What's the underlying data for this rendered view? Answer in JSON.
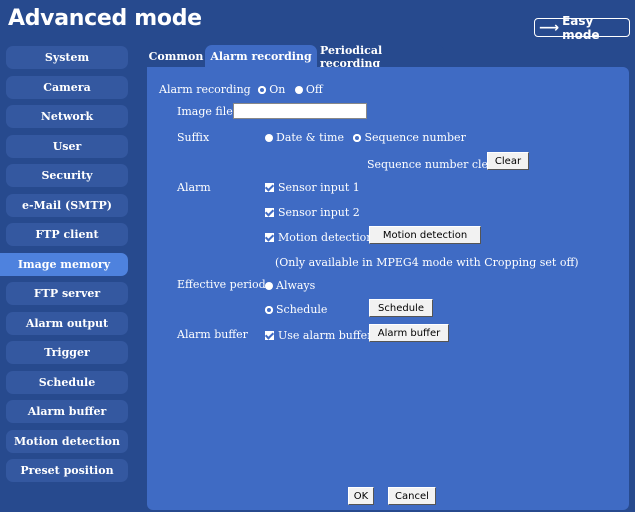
{
  "header": {
    "title": "Advanced mode",
    "easy_mode_label": "Easy mode",
    "easy_mode_icon": "arrow-right-icon"
  },
  "sidebar": {
    "items": [
      {
        "label": "System",
        "active": false
      },
      {
        "label": "Camera",
        "active": false
      },
      {
        "label": "Network",
        "active": false
      },
      {
        "label": "User",
        "active": false
      },
      {
        "label": "Security",
        "active": false
      },
      {
        "label": "e-Mail (SMTP)",
        "active": false
      },
      {
        "label": "FTP client",
        "active": false
      },
      {
        "label": "Image memory",
        "active": true
      },
      {
        "label": "FTP server",
        "active": false
      },
      {
        "label": "Alarm output",
        "active": false
      },
      {
        "label": "Trigger",
        "active": false
      },
      {
        "label": "Schedule",
        "active": false
      },
      {
        "label": "Alarm buffer",
        "active": false
      },
      {
        "label": "Motion detection",
        "active": false
      },
      {
        "label": "Preset position",
        "active": false
      }
    ]
  },
  "tabs": [
    {
      "label": "Common",
      "active": false
    },
    {
      "label": "Alarm recording",
      "active": true
    },
    {
      "label": "Periodical recording",
      "active": false
    }
  ],
  "form": {
    "alarm_recording_label": "Alarm recording",
    "on_label": "On",
    "off_label": "Off",
    "alarm_recording_value": "On",
    "image_file_name_label": "Image file name",
    "image_file_name_value": "",
    "suffix_label": "Suffix",
    "suffix_date_label": "Date & time",
    "suffix_sequence_label": "Sequence number",
    "suffix_value": "Sequence number",
    "sequence_clear_label": "Sequence number clear",
    "clear_button": "Clear",
    "alarm_label": "Alarm",
    "sensor1_label": "Sensor input 1",
    "sensor1_checked": true,
    "sensor2_label": "Sensor input 2",
    "sensor2_checked": true,
    "motion_label": "Motion detection",
    "motion_checked": true,
    "motion_button": "Motion detection",
    "motion_note": "(Only available in MPEG4 mode with Cropping set off)",
    "effective_period_label": "Effective period",
    "always_label": "Always",
    "schedule_label": "Schedule",
    "effective_period_value": "Schedule",
    "schedule_button": "Schedule",
    "alarm_buffer_label": "Alarm buffer",
    "use_alarm_buffer_label": "Use alarm buffer",
    "use_alarm_buffer_checked": true,
    "alarm_buffer_button": "Alarm buffer",
    "ok_button": "OK",
    "cancel_button": "Cancel"
  },
  "colors": {
    "background": "#274a8e",
    "panel": "#3f6bc4",
    "sidebar_item": "#3458a0",
    "sidebar_active": "#4e82de"
  }
}
